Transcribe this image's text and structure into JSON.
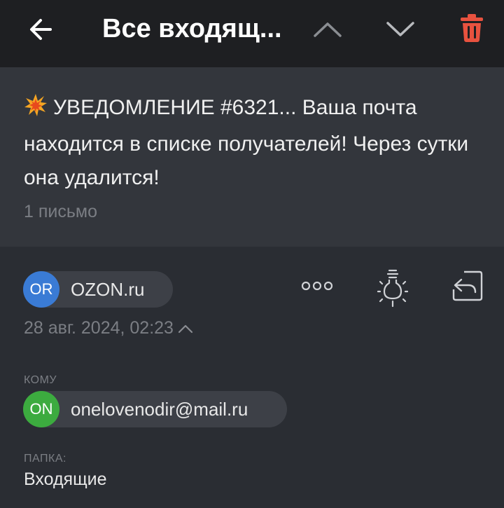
{
  "header": {
    "title": "Все входящ...",
    "back_icon": "arrow-left-icon",
    "prev_icon": "chevron-up-icon",
    "next_icon": "chevron-down-icon",
    "trash_icon": "trash-icon",
    "trash_color": "#e8523f"
  },
  "thread": {
    "subject": "УВЕДОМЛЕНИЕ #6321... Ваша почта находится в списке получателей! Через сутки она удалится!",
    "emoji_icon": "collision-icon",
    "count": "1 письмо"
  },
  "message": {
    "sender": {
      "avatar_initials": "OR",
      "avatar_color": "#3a7bd5",
      "name": "OZON.ru"
    },
    "date": "28 авг. 2024, 02:23",
    "to_label": "КОМУ",
    "recipient": {
      "avatar_initials": "ON",
      "avatar_color": "#3cab3f",
      "email": "onelovenodir@mail.ru"
    },
    "folder_label": "ПАПКА:",
    "folder_value": "Входящие"
  },
  "actions": {
    "more_icon": "more-dots-icon",
    "bulb_icon": "lightbulb-icon",
    "reply_icon": "reply-icon"
  }
}
